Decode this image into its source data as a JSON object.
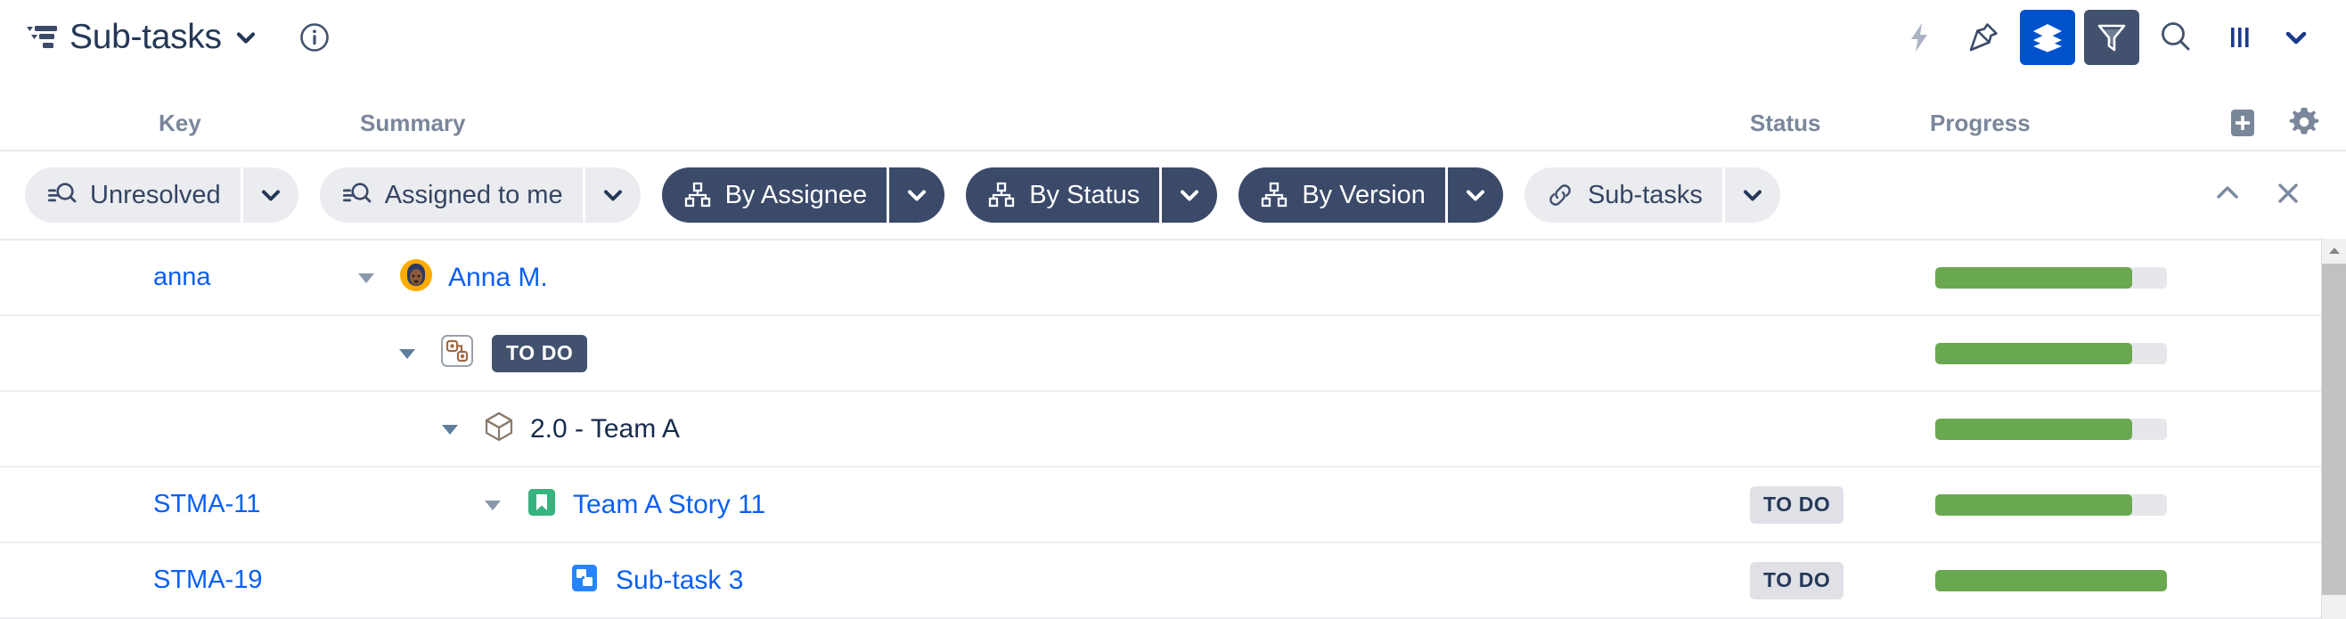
{
  "titlebar": {
    "structure_icon": "structure-icon",
    "title": "Sub-tasks",
    "title_caret_icon": "chevron-down-icon",
    "info_icon": "info-icon",
    "tools": [
      {
        "name": "automation-icon",
        "label": "lightning-bolt",
        "state": "default"
      },
      {
        "name": "pin-icon",
        "label": "pin",
        "state": "default"
      },
      {
        "name": "layers-icon",
        "label": "layers",
        "state": "active-blue"
      },
      {
        "name": "filter-icon",
        "label": "filter",
        "state": "active-dark"
      },
      {
        "name": "search-icon",
        "label": "search",
        "state": "default"
      },
      {
        "name": "columns-icon",
        "label": "columns",
        "state": "default"
      }
    ],
    "tools_caret_icon": "chevron-down-icon"
  },
  "columns": {
    "key": "Key",
    "summary": "Summary",
    "status": "Status",
    "progress": "Progress",
    "add_icon": "add-column-icon",
    "settings_icon": "gear-icon"
  },
  "pills": [
    {
      "label": "Unresolved",
      "icon": "filter-search-icon",
      "style": "light",
      "caret": "chevron-down-icon"
    },
    {
      "label": "Assigned to me",
      "icon": "filter-search-icon",
      "style": "light",
      "caret": "chevron-down-icon"
    },
    {
      "label": "By Assignee",
      "icon": "group-icon",
      "style": "dark",
      "caret": "chevron-down-icon"
    },
    {
      "label": "By Status",
      "icon": "group-icon",
      "style": "dark",
      "caret": "chevron-down-icon"
    },
    {
      "label": "By Version",
      "icon": "group-icon",
      "style": "dark",
      "caret": "chevron-down-icon"
    },
    {
      "label": "Sub-tasks",
      "icon": "link-icon",
      "style": "light",
      "caret": "chevron-down-icon"
    }
  ],
  "pillbar_right": {
    "collapse_icon": "chevron-up-icon",
    "close_icon": "close-icon"
  },
  "rows": [
    {
      "key": "anna",
      "indent": 0,
      "expander": "triangle-down-icon",
      "type_icon": "avatar-icon",
      "summary": "Anna M.",
      "summary_style": "link",
      "inline_badge": "",
      "status": "",
      "progress": 85
    },
    {
      "key": "",
      "indent": 1,
      "expander": "triangle-down-icon",
      "type_icon": "workflow-status-icon",
      "summary": "",
      "summary_style": "plain",
      "inline_badge": "TO DO",
      "status": "",
      "progress": 85
    },
    {
      "key": "",
      "indent": 2,
      "expander": "triangle-down-icon",
      "type_icon": "version-cube-icon",
      "summary": "2.0 - Team A",
      "summary_style": "plain",
      "inline_badge": "",
      "status": "",
      "progress": 85
    },
    {
      "key": "STMA-11",
      "indent": 3,
      "expander": "triangle-down-icon",
      "type_icon": "story-icon",
      "summary": "Team A Story 11",
      "summary_style": "link",
      "inline_badge": "",
      "status": "TO DO",
      "progress": 85
    },
    {
      "key": "STMA-19",
      "indent": 4,
      "expander": "",
      "type_icon": "subtask-icon",
      "summary": "Sub-task 3",
      "summary_style": "link",
      "inline_badge": "",
      "status": "TO DO",
      "progress": 100
    }
  ],
  "scrollbar": {
    "up_icon": "scroll-up-arrow-icon",
    "thumb": "scroll-thumb"
  },
  "colors": {
    "link": "#0a5ff5",
    "accent_blue": "#0052cc",
    "dark_pill": "#3b4a69",
    "badge_dark": "#42526e",
    "progress_green": "#6aa84f",
    "progress_track": "#e5e7ea",
    "header_text": "#7a869a",
    "body_text": "#172b4d"
  }
}
